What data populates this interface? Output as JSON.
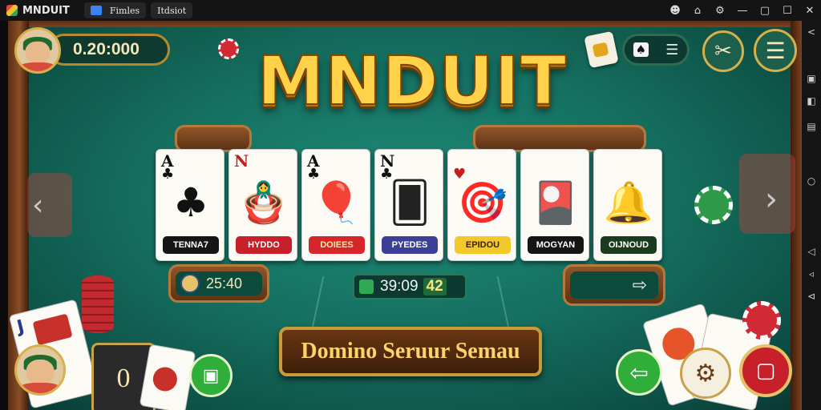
{
  "window": {
    "app_title": "MNDUIT",
    "tabs": [
      {
        "label": "Fimles"
      },
      {
        "label": "Itdsiot"
      }
    ]
  },
  "hud": {
    "balance": "0.20:000",
    "timer_left": "25:40",
    "counter_center": "39:09",
    "counter_extra": "42",
    "left_hand_card": "0"
  },
  "logo": {
    "text": "MNDUIT"
  },
  "cards": [
    {
      "rank": "A",
      "suit": "♣",
      "rank_color": "#111",
      "art": "♣",
      "art_color": "#111",
      "tag": "TENNA7",
      "tag_bg": "#151515",
      "tag_color": "#ffffff"
    },
    {
      "rank": "N",
      "suit": "",
      "rank_color": "#c21f1f",
      "art": "🪆",
      "art_color": "#c46a1d",
      "tag": "HYDDO",
      "tag_bg": "#c8202a",
      "tag_color": "#ffffff"
    },
    {
      "rank": "A",
      "suit": "♣",
      "rank_color": "#111",
      "art": "🎈",
      "art_color": "#2a6ccc",
      "tag": "DOIEES",
      "tag_bg": "#d6262c",
      "tag_color": "#ffe9a0"
    },
    {
      "rank": "N",
      "suit": "♣",
      "rank_color": "#111",
      "art": "🂠",
      "art_color": "#222",
      "tag": "PYEDES",
      "tag_bg": "#3c3f98",
      "tag_color": "#ffffff"
    },
    {
      "rank": "",
      "suit": "♥",
      "rank_color": "#c21f1f",
      "art": "🎯",
      "art_color": "#2a7a3a",
      "tag": "EPIDOU",
      "tag_bg": "#f2c82a",
      "tag_color": "#3a2200"
    },
    {
      "rank": "",
      "suit": "",
      "rank_color": "#111",
      "art": "🎴",
      "art_color": "#c04a1a",
      "tag": "MOGYAN",
      "tag_bg": "#151515",
      "tag_color": "#ffffff"
    },
    {
      "rank": "",
      "suit": "",
      "rank_color": "#111",
      "art": "🔔",
      "art_color": "#d39c1a",
      "tag": "OIJNOUD",
      "tag_bg": "#1b3b1f",
      "tag_color": "#ffffff"
    }
  ],
  "banner": {
    "text": "Domino Seruur Semau"
  },
  "icons": {
    "menu": "hamburger-icon",
    "tools": "tools-icon",
    "back": "arrow-left-icon",
    "forward": "arrow-right-icon"
  },
  "colors": {
    "felt": "#157060",
    "gold": "#ffd24a",
    "wood": "#7a4420",
    "green_button": "#2fae3a",
    "red_button": "#c8202a"
  }
}
